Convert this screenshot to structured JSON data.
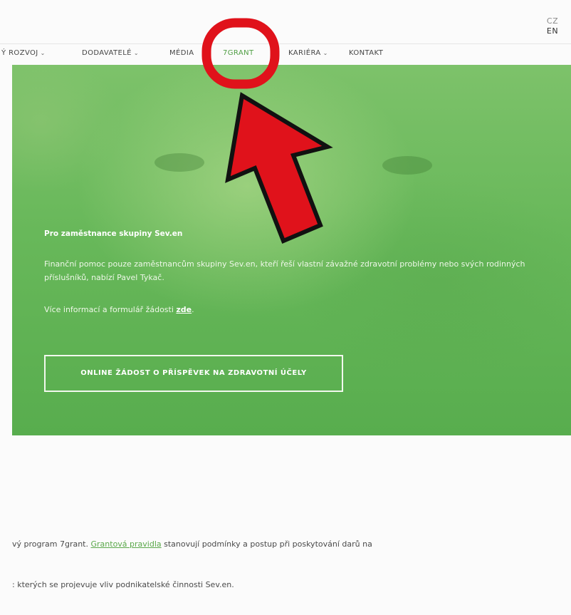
{
  "language": {
    "cz": "CZ",
    "en": "EN"
  },
  "nav": {
    "items": [
      {
        "label": "Ý ROZVOJ",
        "has_dropdown": true
      },
      {
        "label": "DODAVATELÉ",
        "has_dropdown": true
      },
      {
        "label": "MÉDIA",
        "has_dropdown": false
      },
      {
        "label": "7GRANT",
        "has_dropdown": false,
        "active": true
      },
      {
        "label": "KARIÉRA",
        "has_dropdown": true
      },
      {
        "label": "KONTAKT",
        "has_dropdown": false
      }
    ],
    "chevron": "⌄"
  },
  "hero": {
    "title": "Pro zaměstnance skupiny Sev.en",
    "text": "Finanční pomoc pouze zaměstnancům skupiny Sev.en, kteří řeší vlastní závažné zdravotní problémy nebo svých rodinných příslušníků, nabízí Pavel Tykač.",
    "more_prefix": "Více informací a formulář žádosti ",
    "more_link": "zde",
    "more_suffix": ".",
    "button": "ONLINE ŽÁDOST O PŘÍSPĚVEK NA ZDRAVOTNÍ ÚČELY"
  },
  "content": {
    "p1_prefix": "vý program 7grant. ",
    "p1_link": "Grantová pravidla",
    "p1_suffix": " stanovují podmínky a postup při poskytování darů na",
    "p2": ": kterých se projevuje vliv podnikatelské činnosti Sev.en."
  },
  "annotation": {
    "color": "#e0121b",
    "outline": "#111111"
  }
}
